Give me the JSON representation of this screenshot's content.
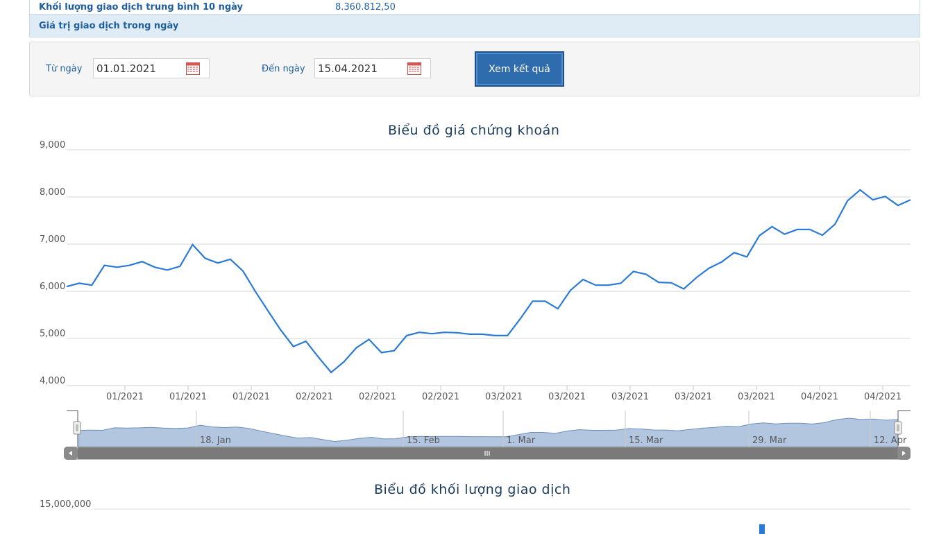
{
  "info": {
    "avg_volume_label": "Khối lượng giao dịch trung bình 10 ngày",
    "avg_volume_value": "8.360.812,50",
    "day_value_label": "Giá trị giao dịch trong ngày"
  },
  "filter": {
    "from_label": "Từ ngày",
    "from_value": "01.01.2021",
    "to_label": "Đến ngày",
    "to_value": "15.04.2021",
    "submit_label": "Xem kết quả"
  },
  "price_chart": {
    "title": "Biểu đồ giá chứng khoán",
    "y_ticks": [
      "9,000",
      "8,000",
      "7,000",
      "6,000",
      "5,000",
      "4,000"
    ],
    "x_ticks": [
      "01/2021",
      "01/2021",
      "01/2021",
      "02/2021",
      "02/2021",
      "02/2021",
      "03/2021",
      "03/2021",
      "03/2021",
      "03/2021",
      "03/2021",
      "04/2021",
      "04/2021"
    ],
    "navigator_labels": [
      "18. Jan",
      "15. Feb",
      "1. Mar",
      "15. Mar",
      "29. Mar",
      "12. Apr"
    ],
    "line_color": "#2a7ad6"
  },
  "chart_data": {
    "type": "line",
    "ylim": [
      4000,
      9000
    ],
    "grid": true,
    "values": [
      6100,
      6170,
      6130,
      6550,
      6510,
      6550,
      6630,
      6510,
      6450,
      6530,
      6990,
      6700,
      6600,
      6680,
      6430,
      5990,
      5580,
      5180,
      4830,
      4940,
      4600,
      4280,
      4500,
      4800,
      4980,
      4700,
      4740,
      5060,
      5130,
      5100,
      5130,
      5120,
      5090,
      5090,
      5060,
      5060,
      5410,
      5790,
      5790,
      5630,
      6020,
      6250,
      6130,
      6130,
      6170,
      6420,
      6360,
      6190,
      6180,
      6050,
      6290,
      6490,
      6620,
      6820,
      6730,
      7180,
      7370,
      7210,
      7310,
      7310,
      7190,
      7420,
      7920,
      8150,
      7940,
      8010,
      7820,
      7940
    ]
  },
  "volume_chart": {
    "title": "Biểu đồ khối lượng giao dịch",
    "y_ticks": [
      "15,000,000"
    ]
  }
}
